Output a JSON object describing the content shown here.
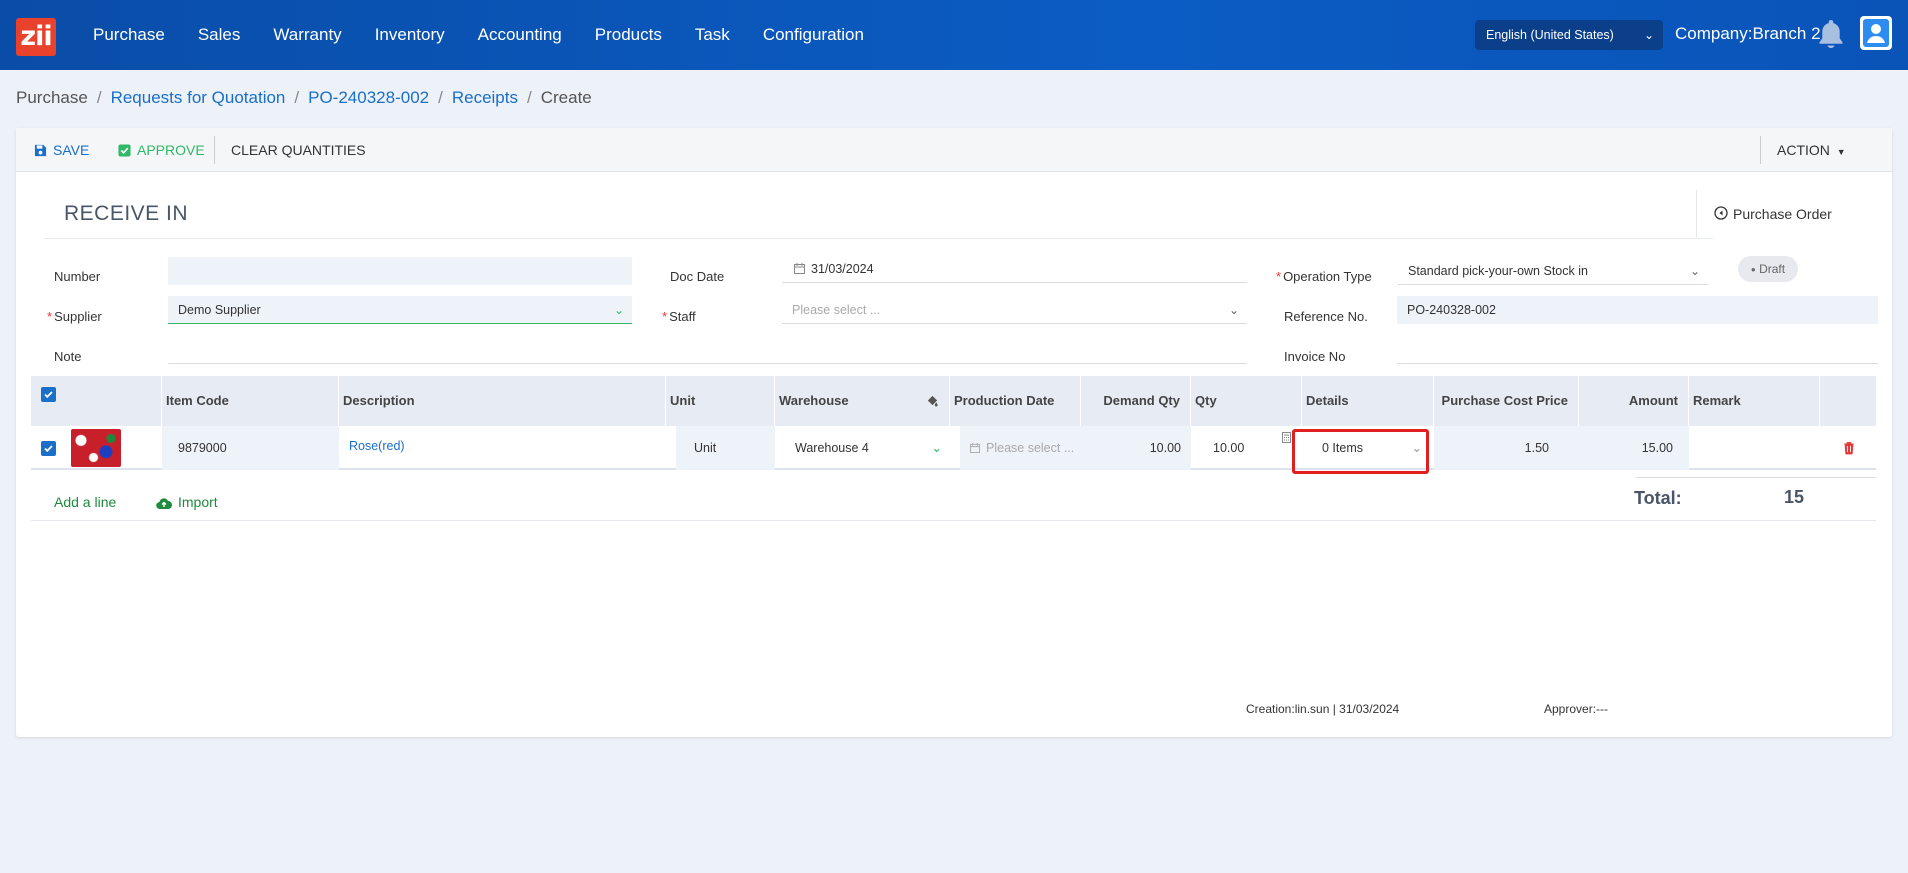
{
  "nav": {
    "logo": "zii",
    "items": [
      "Purchase",
      "Sales",
      "Warranty",
      "Inventory",
      "Accounting",
      "Products",
      "Task",
      "Configuration"
    ],
    "language": "English (United States)",
    "company": "Company:Branch 2"
  },
  "breadcrumb": {
    "root": "Purchase",
    "rfq": "Requests for Quotation",
    "po": "PO-240328-002",
    "receipts": "Receipts",
    "current": "Create"
  },
  "toolbar": {
    "save": "SAVE",
    "approve": "APPROVE",
    "clear": "CLEAR QUANTITIES",
    "action": "ACTION"
  },
  "form": {
    "title": "RECEIVE IN",
    "purchase_order_link": "Purchase Order",
    "status": "Draft",
    "number_label": "Number",
    "number_value": "",
    "supplier_label": "Supplier",
    "supplier_value": "Demo Supplier",
    "note_label": "Note",
    "note_value": "",
    "doc_date_label": "Doc Date",
    "doc_date_value": "31/03/2024",
    "staff_label": "Staff",
    "staff_placeholder": "Please select ...",
    "operation_type_label": "Operation Type",
    "operation_type_value": "Standard pick-your-own Stock in",
    "reference_label": "Reference No.",
    "reference_value": "PO-240328-002",
    "invoice_label": "Invoice No",
    "invoice_value": ""
  },
  "table": {
    "headers": {
      "item_code": "Item Code",
      "description": "Description",
      "unit": "Unit",
      "warehouse": "Warehouse",
      "production_date": "Production Date",
      "demand_qty": "Demand Qty",
      "qty": "Qty",
      "details": "Details",
      "purchase_cost_price": "Purchase Cost Price",
      "amount": "Amount",
      "remark": "Remark"
    },
    "rows": [
      {
        "item_code": "9879000",
        "description": "Rose(red)",
        "unit": "Unit",
        "warehouse": "Warehouse 4",
        "production_date_placeholder": "Please select ...",
        "demand_qty": "10.00",
        "qty": "10.00",
        "details": "0 Items",
        "purchase_cost_price": "1.50",
        "amount": "15.00",
        "remark": ""
      }
    ],
    "add_line": "Add a line",
    "import": "Import",
    "total_label": "Total:",
    "total_value": "15"
  },
  "footer": {
    "creation": "Creation:lin.sun | 31/03/2024",
    "approver": "Approver:---"
  },
  "colors": {
    "nav_bg": "#0b5cc4",
    "link": "#1a6fc9",
    "approve": "#2fb866",
    "add_line": "#1e8a3e",
    "highlight": "#e02020",
    "trash": "#e33b3b"
  }
}
